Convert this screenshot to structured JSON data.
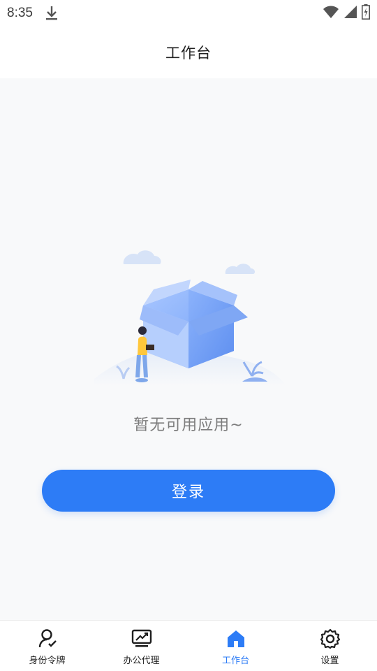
{
  "status_bar": {
    "time": "8:35",
    "icons": [
      "download-icon",
      "wifi-icon",
      "signal-icon",
      "battery-charging-icon"
    ]
  },
  "header": {
    "title": "工作台"
  },
  "main": {
    "empty_message": "暂无可用应用~",
    "login_label": "登录",
    "illustration": "empty-box-illustration"
  },
  "bottom_nav": {
    "items": [
      {
        "label": "身份令牌",
        "icon": "identity-token-icon",
        "active": false
      },
      {
        "label": "办公代理",
        "icon": "office-proxy-icon",
        "active": false
      },
      {
        "label": "工作台",
        "icon": "home-icon",
        "active": true
      },
      {
        "label": "设置",
        "icon": "gear-icon",
        "active": false
      }
    ]
  },
  "colors": {
    "accent": "#2d7cf6",
    "background": "#f8f9fa",
    "text_primary": "#222222",
    "text_secondary": "#7d7d7d"
  }
}
